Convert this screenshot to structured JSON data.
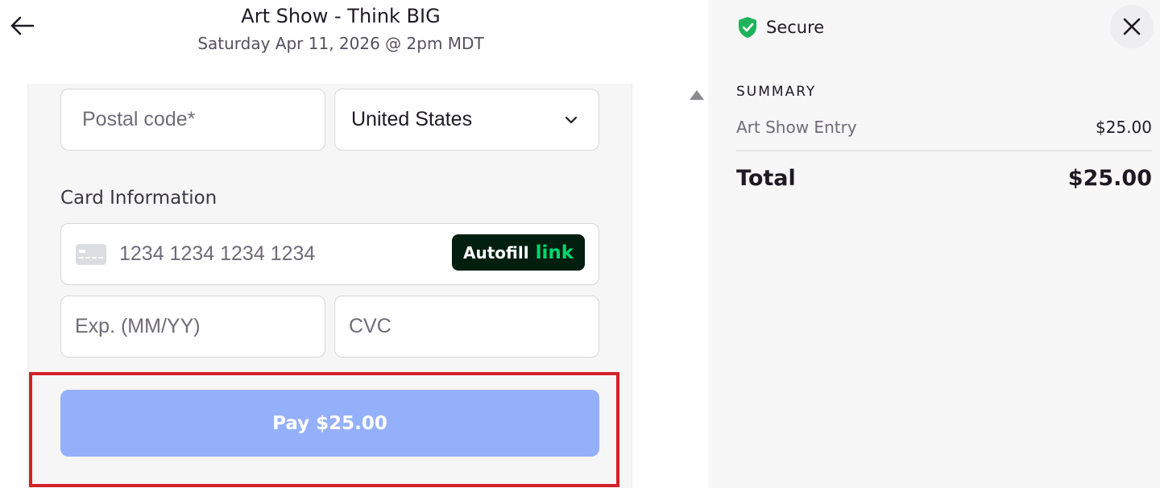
{
  "header": {
    "event_title": "Art Show - Think BIG",
    "event_date": "Saturday Apr 11, 2026 @ 2pm MDT"
  },
  "form": {
    "postal_code": {
      "placeholder": "Postal code*",
      "value": ""
    },
    "country": {
      "selected": "United States"
    },
    "card_section_label": "Card Information",
    "card_number": {
      "placeholder": "1234 1234 1234 1234",
      "value": ""
    },
    "autofill_button": {
      "label": "Autofill",
      "brand": "link"
    },
    "expiry": {
      "placeholder": "Exp. (MM/YY)",
      "value": ""
    },
    "cvc": {
      "placeholder": "CVC",
      "value": ""
    },
    "pay_button_label": "Pay $25.00"
  },
  "summary": {
    "secure_label": "Secure",
    "heading": "SUMMARY",
    "items": [
      {
        "name": "Art Show Entry",
        "price": "$25.00"
      }
    ],
    "total_label": "Total",
    "total_value": "$25.00"
  },
  "colors": {
    "pay_button": "#95b0fb",
    "highlight_border": "#d3202a",
    "secure_shield": "#1eb35a",
    "link_brand": "#00d66f",
    "autofill_bg": "#011e0f"
  },
  "icons": [
    "back-arrow-icon",
    "chevron-down-icon",
    "credit-card-icon",
    "shield-check-icon",
    "close-icon",
    "scroll-up-icon"
  ]
}
